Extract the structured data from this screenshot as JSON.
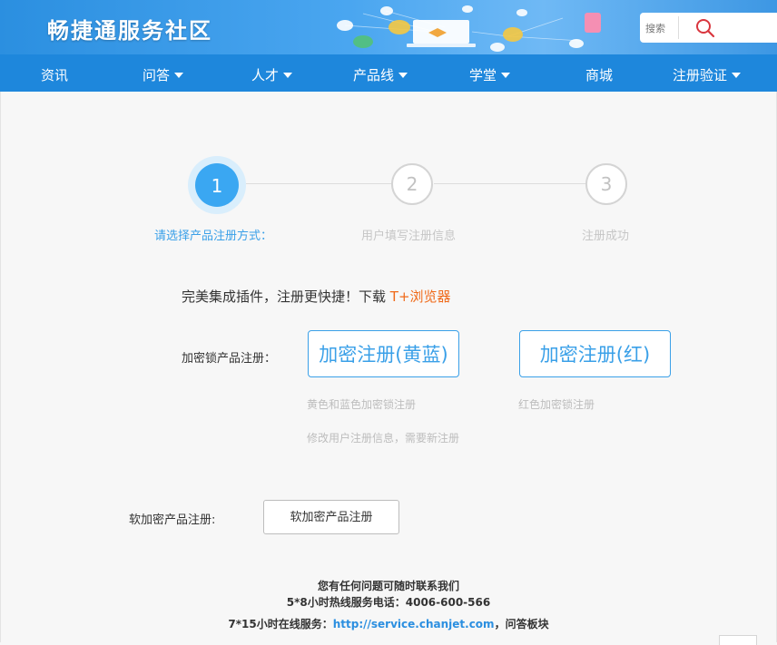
{
  "header": {
    "logo": "畅捷通服务社区",
    "search_placeholder": "搜索"
  },
  "nav": {
    "items": [
      {
        "label": "资讯",
        "has_dropdown": false
      },
      {
        "label": "问答",
        "has_dropdown": true
      },
      {
        "label": "人才",
        "has_dropdown": true
      },
      {
        "label": "产品线",
        "has_dropdown": true
      },
      {
        "label": "学堂",
        "has_dropdown": true
      },
      {
        "label": "商城",
        "has_dropdown": false
      },
      {
        "label": "注册验证",
        "has_dropdown": true
      }
    ]
  },
  "steps": [
    {
      "number": "1",
      "label": "请选择产品注册方式：",
      "active": true
    },
    {
      "number": "2",
      "label": "用户填写注册信息",
      "active": false
    },
    {
      "number": "3",
      "label": "注册成功",
      "active": false
    }
  ],
  "tip": {
    "text": "完美集成插件，注册更快捷！下载 ",
    "link": "T+浏览器"
  },
  "encrypted": {
    "label": "加密锁产品注册：",
    "yellow_blue_button": "加密注册(黄蓝)",
    "red_button": "加密注册(红)",
    "yellow_blue_note": "黄色和蓝色加密锁注册",
    "yellow_blue_note2": "修改用户注册信息，需要新注册",
    "red_note": "红色加密锁注册"
  },
  "soft": {
    "label": "软加密产品注册:",
    "button": "软加密产品注册"
  },
  "footer": {
    "line1": "您有任何问题可随时联系我们",
    "line2": "5*8小时热线服务电话：4006-600-566",
    "line3_prefix": "7*15小时在线服务：",
    "line3_link": "http://service.chanjet.com",
    "line3_suffix": "，问答板块"
  },
  "colors": {
    "nav_bg": "#1e87dc",
    "accent_blue": "#3aa7f2",
    "link_orange": "#f06a1a"
  }
}
